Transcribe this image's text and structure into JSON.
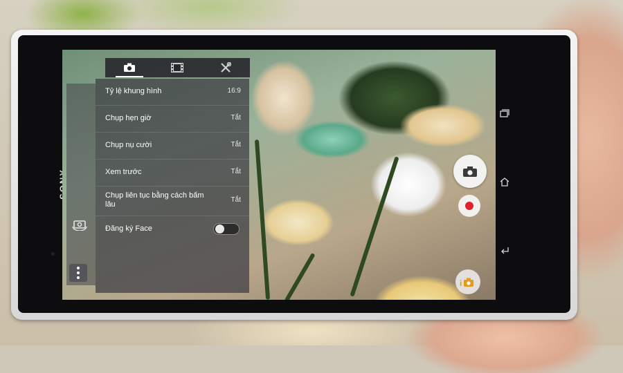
{
  "device": {
    "brand": "SONY"
  },
  "tabs": [
    {
      "icon": "camera-icon",
      "active": true
    },
    {
      "icon": "film-icon",
      "active": false
    },
    {
      "icon": "tools-icon",
      "active": false
    }
  ],
  "settings": [
    {
      "label": "Tỷ lệ khung hình",
      "value": "16:9"
    },
    {
      "label": "Chụp hẹn giờ",
      "value": "Tắt"
    },
    {
      "label": "Chụp nụ cười",
      "value": "Tắt"
    },
    {
      "label": "Xem trước",
      "value": "Tắt"
    },
    {
      "label": "Chụp liên tục bằng cách bấm lâu",
      "value": "Tắt"
    }
  ],
  "face_register": {
    "label": "Đăng ký Face",
    "enabled": false
  },
  "controls": {
    "shutter_icon": "camera-icon",
    "record_icon": "record-icon",
    "mode_icon": "intelligent-auto-icon",
    "mode_text": "i",
    "switch_camera_icon": "switch-camera-icon",
    "menu_icon": "more-vertical-icon"
  },
  "nav": [
    "recent-apps-icon",
    "home-icon",
    "back-icon"
  ],
  "colors": {
    "record": "#e0202a",
    "panel": "#3c3c42",
    "accent": "#ffffff"
  }
}
